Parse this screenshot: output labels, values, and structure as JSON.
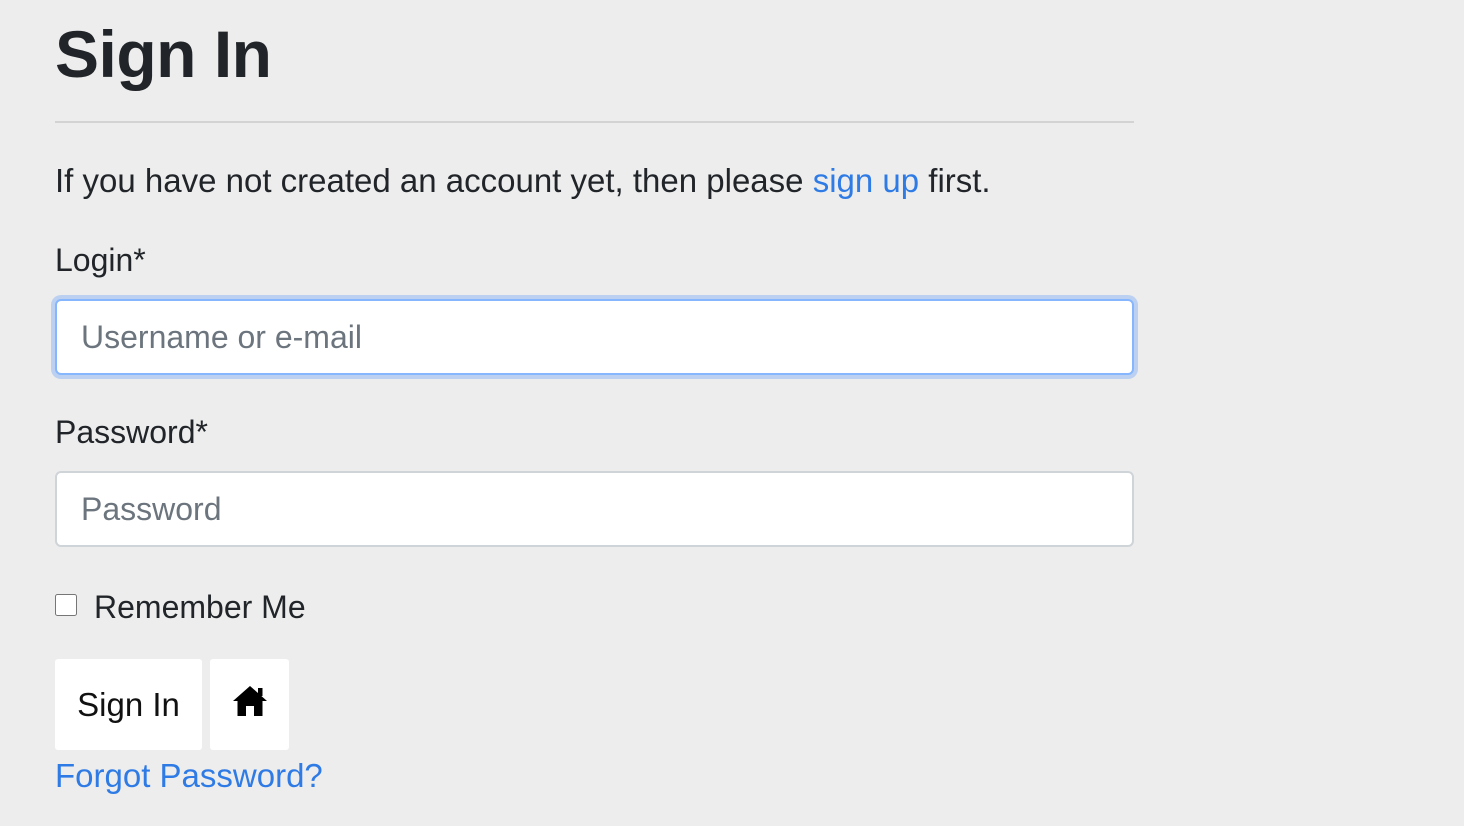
{
  "page": {
    "title": "Sign In",
    "intro_before": "If you have not created an account yet, then please ",
    "intro_link": "sign up",
    "intro_after": " first."
  },
  "form": {
    "login_label": "Login*",
    "login_placeholder": "Username or e-mail",
    "login_value": "",
    "password_label": "Password*",
    "password_placeholder": "Password",
    "password_value": "",
    "remember_label": "Remember Me",
    "remember_checked": false
  },
  "actions": {
    "signin_label": "Sign In",
    "home_icon": "home-icon",
    "forgot_label": "Forgot Password?"
  },
  "colors": {
    "background": "#ededed",
    "link": "#2f7be6",
    "focus_border": "#86b7fe"
  }
}
